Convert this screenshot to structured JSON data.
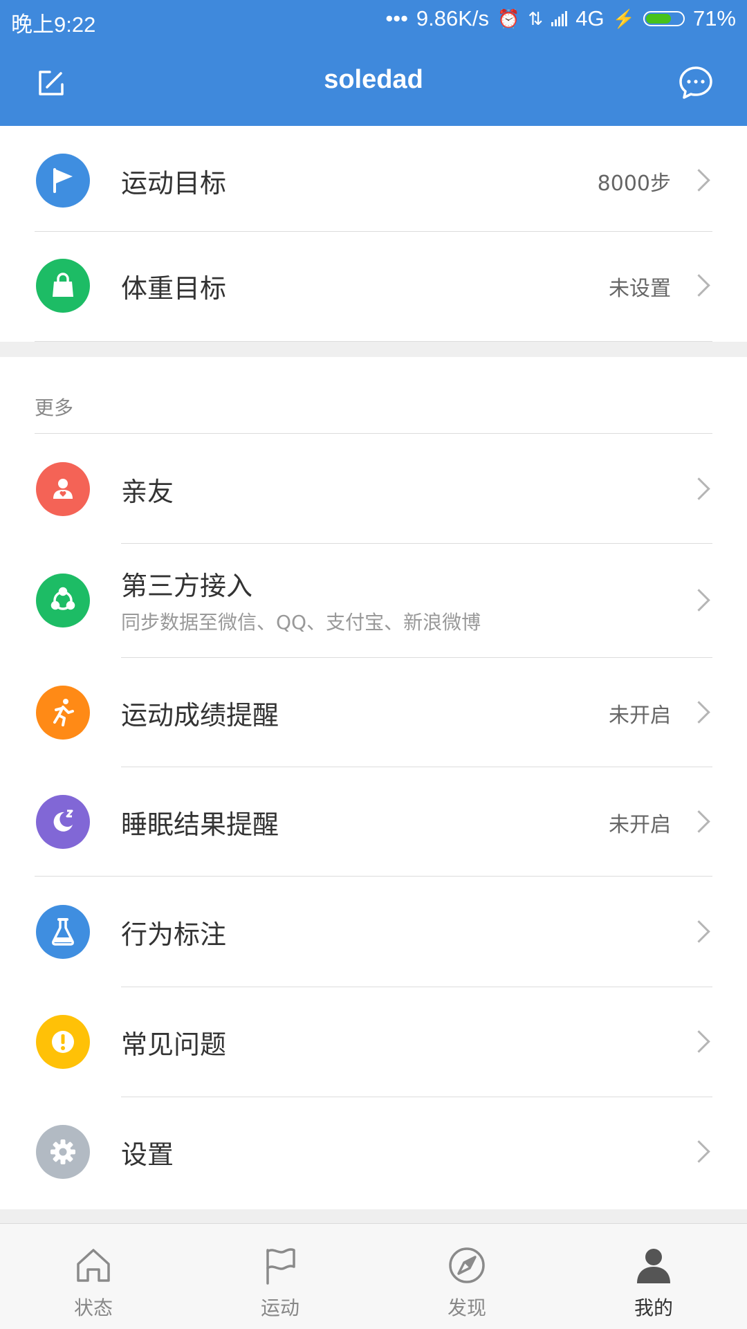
{
  "status_bar": {
    "time": "晚上9:22",
    "dots": "•••",
    "speed": "9.86K/s",
    "network": "4G",
    "battery": "71%",
    "battery_level": 0.71
  },
  "header": {
    "title": "soledad",
    "edit_icon": "edit-icon",
    "message_icon": "chat-bubble-icon"
  },
  "goals": [
    {
      "title": "运动目标",
      "value": "8000步",
      "icon": "flag-icon",
      "color": "#3f8ee0"
    },
    {
      "title": "体重目标",
      "value": "未设置",
      "icon": "bag-icon",
      "color": "#1dbc65"
    }
  ],
  "more": {
    "section_title": "更多",
    "items": [
      {
        "title": "亲友",
        "subtitle": "",
        "value": "",
        "icon": "friend-icon",
        "color": "#f46356"
      },
      {
        "title": "第三方接入",
        "subtitle": "同步数据至微信、QQ、支付宝、新浪微博",
        "value": "",
        "icon": "share-icon",
        "color": "#1dbc65"
      },
      {
        "title": "运动成绩提醒",
        "subtitle": "",
        "value": "未开启",
        "icon": "runner-icon",
        "color": "#ff8a16"
      },
      {
        "title": "睡眠结果提醒",
        "subtitle": "",
        "value": "未开启",
        "icon": "sleep-icon",
        "color": "#8167d6"
      },
      {
        "title": "行为标注",
        "subtitle": "",
        "value": "",
        "icon": "flask-icon",
        "color": "#3f8ee0"
      },
      {
        "title": "常见问题",
        "subtitle": "",
        "value": "",
        "icon": "exclamation-icon",
        "color": "#ffc107"
      },
      {
        "title": "设置",
        "subtitle": "",
        "value": "",
        "icon": "gear-icon",
        "color": "#b2bac3"
      }
    ]
  },
  "tabs": [
    {
      "label": "状态",
      "icon": "home-icon",
      "active": false
    },
    {
      "label": "运动",
      "icon": "flag-outline-icon",
      "active": false
    },
    {
      "label": "发现",
      "icon": "compass-icon",
      "active": false
    },
    {
      "label": "我的",
      "icon": "person-icon",
      "active": true
    }
  ]
}
